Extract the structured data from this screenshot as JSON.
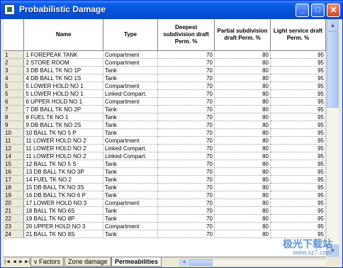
{
  "window": {
    "title": "Probabilistic Damage",
    "minimize_glyph": "_",
    "maximize_glyph": "□",
    "close_glyph": "✕"
  },
  "grid": {
    "columns": [
      {
        "key": "name",
        "label": "Name"
      },
      {
        "key": "type",
        "label": "Type"
      },
      {
        "key": "deepest",
        "label": "Deepest subdivision draft Perm. %"
      },
      {
        "key": "partial",
        "label": "Partial subdivision draft Perm. %"
      },
      {
        "key": "light",
        "label": "Light service draft Perm. %"
      }
    ],
    "rows": [
      {
        "idx": "1",
        "name": "1 FOREPEAK TANK",
        "type": "Compartment",
        "deepest": "70",
        "partial": "80",
        "light": "95"
      },
      {
        "idx": "2",
        "name": "2 STORE ROOM",
        "type": "Compartment",
        "deepest": "70",
        "partial": "80",
        "light": "95"
      },
      {
        "idx": "3",
        "name": "3 DB BALL TK NO 1P",
        "type": "Tank",
        "deepest": "70",
        "partial": "80",
        "light": "95"
      },
      {
        "idx": "4",
        "name": "4 DB BALL TK NO 1S",
        "type": "Tank",
        "deepest": "70",
        "partial": "80",
        "light": "95"
      },
      {
        "idx": "5",
        "name": "5 LOWER HOLD NO 1",
        "type": "Compartment",
        "deepest": "70",
        "partial": "80",
        "light": "95"
      },
      {
        "idx": "5",
        "name": "5 LOWER HOLD NO 1",
        "type": "Linked Compart.",
        "deepest": "70",
        "partial": "80",
        "light": "95"
      },
      {
        "idx": "6",
        "name": "6 UPPER HOLD NO 1",
        "type": "Compartment",
        "deepest": "70",
        "partial": "80",
        "light": "95"
      },
      {
        "idx": "7",
        "name": "7  DB BALL TK NO 2P",
        "type": "Tank",
        "deepest": "70",
        "partial": "80",
        "light": "95"
      },
      {
        "idx": "8",
        "name": "8 FUEL TK NO 1",
        "type": "Tank",
        "deepest": "70",
        "partial": "80",
        "light": "95"
      },
      {
        "idx": "9",
        "name": "9  DB BALL TK NO 2S",
        "type": "Tank",
        "deepest": "70",
        "partial": "80",
        "light": "95"
      },
      {
        "idx": "10",
        "name": "10 BALL TK NO 5 P",
        "type": "Tank",
        "deepest": "70",
        "partial": "80",
        "light": "95"
      },
      {
        "idx": "11",
        "name": "11 LOWER HOLD NO 2",
        "type": "Compartment",
        "deepest": "70",
        "partial": "80",
        "light": "95"
      },
      {
        "idx": "12",
        "name": "11 LOWER HOLD NO 2",
        "type": "Linked Compart.",
        "deepest": "70",
        "partial": "80",
        "light": "95"
      },
      {
        "idx": "14",
        "name": "11 LOWER HOLD NO 2",
        "type": "Linked Compart.",
        "deepest": "70",
        "partial": "80",
        "light": "95"
      },
      {
        "idx": "15",
        "name": "12 BALL TK NO 5 S",
        "type": "Tank",
        "deepest": "70",
        "partial": "80",
        "light": "95"
      },
      {
        "idx": "16",
        "name": "13 DB BALL TK NO 3P",
        "type": "Tank",
        "deepest": "70",
        "partial": "80",
        "light": "95"
      },
      {
        "idx": "17",
        "name": "14 FUEL TK NO 2",
        "type": "Tank",
        "deepest": "70",
        "partial": "80",
        "light": "95"
      },
      {
        "idx": "18",
        "name": "15 DB BALL TK NO 3S",
        "type": "Tank",
        "deepest": "70",
        "partial": "80",
        "light": "95"
      },
      {
        "idx": "19",
        "name": "16 DB BALL TK NO 6 P",
        "type": "Tank",
        "deepest": "70",
        "partial": "80",
        "light": "95"
      },
      {
        "idx": "20",
        "name": "17 LOWER HOLD NO 3",
        "type": "Compartment",
        "deepest": "70",
        "partial": "80",
        "light": "95"
      },
      {
        "idx": "21",
        "name": "18 BALL TK NO 6S",
        "type": "Tank",
        "deepest": "70",
        "partial": "80",
        "light": "95"
      },
      {
        "idx": "22",
        "name": "19 BALL TK NO 8P",
        "type": "Tank",
        "deepest": "70",
        "partial": "80",
        "light": "95"
      },
      {
        "idx": "23",
        "name": "20 UPPER HOLD NO 3",
        "type": "Compartment",
        "deepest": "70",
        "partial": "80",
        "light": "95"
      },
      {
        "idx": "24",
        "name": "21 BALL TK NO 8S",
        "type": "Tank",
        "deepest": "70",
        "partial": "80",
        "light": "95"
      }
    ]
  },
  "tabs": {
    "nav_first": "|◄",
    "nav_prev": "◄",
    "nav_next": "►",
    "nav_last": "►|",
    "items": [
      {
        "label": "v Factors"
      },
      {
        "label": "Zone damage"
      },
      {
        "label": "Permeabilities",
        "active": true
      }
    ]
  },
  "scroll_glyphs": {
    "up": "▲",
    "down": "▼",
    "left": "◄",
    "right": "►"
  },
  "watermark": {
    "text": "极光下载站",
    "url": "www.xz7.com"
  }
}
